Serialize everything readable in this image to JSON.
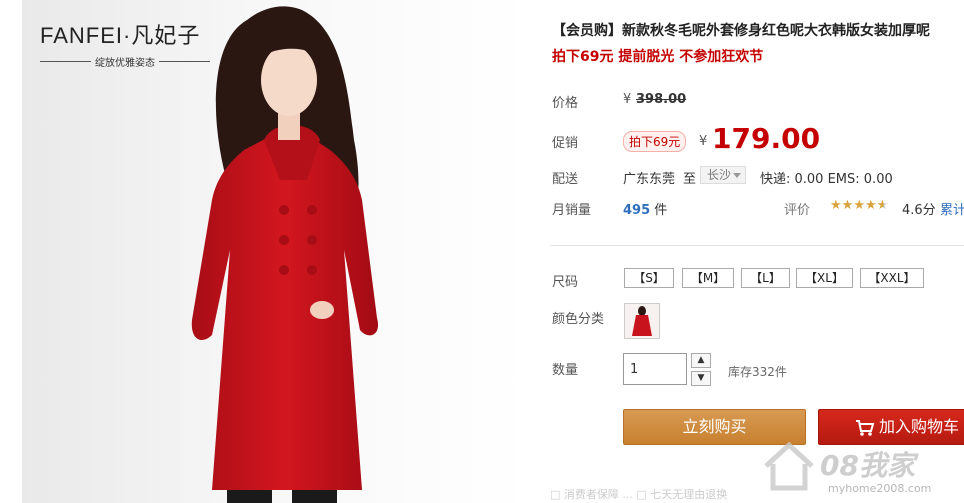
{
  "brand": {
    "name": "FANFEI·凡妃子",
    "tagline": "绽放优雅姿态"
  },
  "product": {
    "title": "【会员购】新款秋冬毛呢外套修身红色呢大衣韩版女装加厚呢",
    "subtitle": "拍下69元 提前脱光 不参加狂欢节"
  },
  "price": {
    "label": "价格",
    "currency": "¥",
    "original": "398.00"
  },
  "promo": {
    "label": "促销",
    "badge": "拍下69元",
    "currency": "¥",
    "price": "179.00"
  },
  "shipping": {
    "label": "配送",
    "from": "广东东莞",
    "to_word": "至",
    "destination": "长沙",
    "fees": "快递: 0.00 EMS: 0.00"
  },
  "sales": {
    "label": "月销量",
    "count": "495",
    "unit": "件",
    "rating_label": "评价",
    "rating": "4.6分",
    "cumulative_label": "累计",
    "stars_filled": 4.6,
    "star_color": "#d9a23a"
  },
  "size": {
    "label": "尺码",
    "options": [
      "【S】",
      "【M】",
      "【L】",
      "【XL】",
      "【XXL】"
    ]
  },
  "color": {
    "label": "颜色分类"
  },
  "quantity": {
    "label": "数量",
    "value": "1",
    "stock": "库存332件",
    "up_icon": "chevron-up-icon",
    "down_icon": "chevron-down-icon"
  },
  "actions": {
    "buy": "立刻购买",
    "cart": "加入购物车",
    "cart_icon": "shopping-cart-icon"
  },
  "bottom_hint": "□ 消费者保障 ... □ 七天无理由退换",
  "watermark": {
    "main": "08我家",
    "sub": "myhome2008.com"
  },
  "colors": {
    "accent_red": "#c40000",
    "buy_orange": "#c8802f",
    "cart_red": "#c0200f",
    "coat_red": "#c8121c",
    "link_blue": "#2f6fbc"
  }
}
